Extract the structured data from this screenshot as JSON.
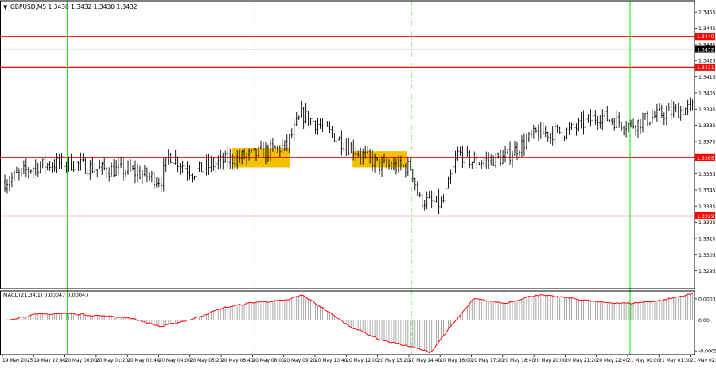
{
  "window": {
    "header": "GBPUSD,M5  1.3430 1.3432 1.3430 1.3432",
    "menu_glyph": "▼"
  },
  "colors": {
    "background": "#ffffff",
    "frame": "#000000",
    "bar": "#000000",
    "level_line": "#ff0000",
    "session_line": "#00e000",
    "highlight": "#f5c000",
    "macd_line": "#ff0000",
    "macd_hist": "#a0a0a0",
    "label_text": "#ffffff",
    "current_price_label": "#000000"
  },
  "chart_data": [
    {
      "type": "candlestick",
      "symbol": "GBPUSD",
      "timeframe": "M5",
      "header_ohlc": {
        "open": 1.343,
        "high": 1.3432,
        "low": 1.343,
        "close": 1.3432
      },
      "ylim": [
        1.3284,
        1.3462
      ],
      "y_ticks": [
        "1.3455",
        "1.3445",
        "1.3435",
        "1.3425",
        "1.3415",
        "1.3405",
        "1.3395",
        "1.3385",
        "1.3375",
        "1.3365",
        "1.3355",
        "1.3345",
        "1.3335",
        "1.3325",
        "1.3315",
        "1.3305",
        "1.3295"
      ],
      "levels": [
        {
          "price": 1.344,
          "label": "1.3440"
        },
        {
          "price": 1.3421,
          "label": "1.3421"
        },
        {
          "price": 1.3365,
          "label": "1.3365"
        },
        {
          "price": 1.3329,
          "label": "1.3329"
        }
      ],
      "current_price": {
        "price": 1.3432,
        "label": "1.3432"
      },
      "x_labels": [
        "19 May 2025",
        "19 May 22:40",
        "20 May 00:00",
        "20 May 01:20",
        "20 May 02:40",
        "20 May 04:00",
        "20 May 05:20",
        "20 May 06:40",
        "20 May 08:00",
        "20 May 09:20",
        "20 May 10:40",
        "20 May 12:00",
        "20 May 13:20",
        "20 May 14:40",
        "20 May 16:00",
        "20 May 17:20",
        "20 May 18:40",
        "20 May 20:00",
        "20 May 21:20",
        "20 May 22:40",
        "21 May 00:00",
        "21 May 01:30",
        "21 May 02:50"
      ],
      "session_lines": [
        {
          "label": "20 May 00:00",
          "style": "solid"
        },
        {
          "label": "20 May 08:00",
          "style": "dashdot"
        },
        {
          "label": "20 May 14:40",
          "style": "dashdot"
        },
        {
          "label": "21 May 00:00",
          "style": "solid"
        }
      ],
      "highlight_zones": [
        {
          "x_from": "20 May 07:00",
          "x_to": "20 May 09:30",
          "price_low": 1.3359,
          "price_high": 1.3371
        },
        {
          "x_from": "20 May 12:10",
          "x_to": "20 May 14:30",
          "price_low": 1.3359,
          "price_high": 1.3369
        }
      ],
      "close_path": {
        "x": [
          "19 May 2025",
          "19 May 22:40",
          "20 May 00:00",
          "20 May 01:20",
          "20 May 02:40",
          "20 May 04:00",
          "20 May 04:20",
          "20 May 05:20",
          "20 May 06:40",
          "20 May 08:00",
          "20 May 09:20",
          "20 May 10:00",
          "20 May 10:40",
          "20 May 12:00",
          "20 May 13:20",
          "20 May 14:40",
          "20 May 15:00",
          "20 May 16:00",
          "20 May 16:40",
          "20 May 17:20",
          "20 May 18:40",
          "20 May 20:00",
          "20 May 21:20",
          "20 May 22:40",
          "21 May 00:00",
          "21 May 01:30",
          "21 May 02:50"
        ],
        "y": [
          1.335,
          1.336,
          1.3362,
          1.3358,
          1.3357,
          1.3351,
          1.3367,
          1.3356,
          1.3363,
          1.3367,
          1.3372,
          1.3392,
          1.3386,
          1.3372,
          1.336,
          1.3359,
          1.3339,
          1.3336,
          1.3368,
          1.3362,
          1.3365,
          1.338,
          1.3381,
          1.3391,
          1.3385,
          1.3392,
          1.3396
        ]
      }
    },
    {
      "type": "histogram",
      "title": "MACD(21,34,1) 0.00047 0.00047",
      "ylim": [
        -0.00062,
        0.00052
      ],
      "y_ticks": [
        "0.00038",
        "0.00",
        "-0.00055"
      ],
      "signal_line": true,
      "path": {
        "x": [
          "19 May 2025",
          "19 May 22:40",
          "20 May 00:00",
          "20 May 01:20",
          "20 May 02:40",
          "20 May 04:00",
          "20 May 05:20",
          "20 May 06:40",
          "20 May 08:00",
          "20 May 09:20",
          "20 May 10:00",
          "20 May 10:40",
          "20 May 12:00",
          "20 May 13:20",
          "20 May 14:40",
          "20 May 15:30",
          "20 May 16:00",
          "20 May 17:20",
          "20 May 18:40",
          "20 May 20:00",
          "20 May 21:20",
          "20 May 22:40",
          "21 May 00:00",
          "21 May 01:30",
          "21 May 02:50"
        ],
        "y": [
          0.0,
          0.0001,
          0.00012,
          8e-05,
          4e-05,
          -0.00012,
          2e-05,
          0.00022,
          0.00032,
          0.00035,
          0.00045,
          0.00028,
          -0.0001,
          -0.00035,
          -0.00048,
          -0.00058,
          -0.0003,
          0.00038,
          0.0003,
          0.00045,
          0.0004,
          0.00032,
          0.0003,
          0.00035,
          0.00047
        ]
      }
    }
  ]
}
